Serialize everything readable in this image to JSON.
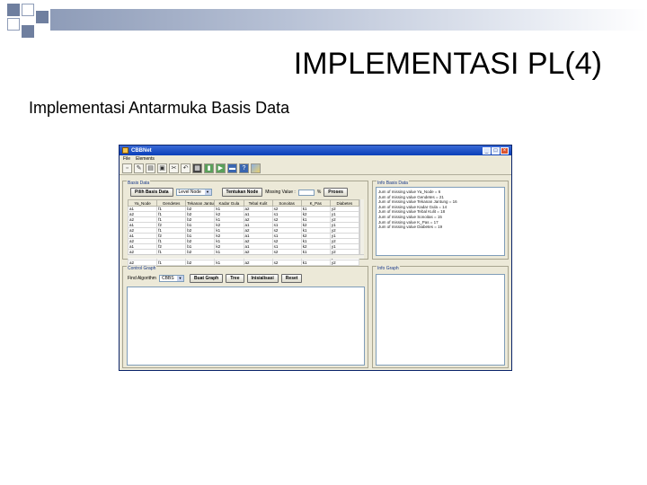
{
  "slide": {
    "title": "IMPLEMENTASI PL(4)",
    "subtitle": "Implementasi Antarmuka Basis Data"
  },
  "colors": {
    "window_border": "#0a246a",
    "titlebar": "#0a3fb8",
    "accent_band": "#8e9cb8"
  },
  "app": {
    "title": "CBBNet",
    "menu": [
      "File",
      "Elements"
    ],
    "toolbar_icons": [
      "new-icon",
      "edit-icon",
      "open-icon",
      "save-icon",
      "cut-icon",
      "undo-icon",
      "grid-icon",
      "export-icon",
      "play-icon",
      "chart-icon",
      "help-icon",
      "image-icon"
    ],
    "basis_data": {
      "label": "Basis Data",
      "pilih_button": "Pilih Basis Data",
      "combo_value": "Level Node",
      "tentukan_button": "Tentukan Node",
      "missing_label": "Missing Value :",
      "missing_unit": "%",
      "proses_button": "Proses",
      "columns": [
        "Ya_Node",
        "Gendetes",
        "Tekanan Jantung",
        "Kadar Gula",
        "Tebal Kulit",
        "Sonoitas",
        "K_Pas",
        "Diabetes"
      ],
      "rows": [
        [
          "a1",
          "f1",
          "b2",
          "k1",
          "a2",
          "s2",
          "k1",
          "y2"
        ],
        [
          "a2",
          "f1",
          "b2",
          "k2",
          "a1",
          "s1",
          "k2",
          "y1"
        ],
        [
          "a2",
          "f1",
          "b2",
          "k1",
          "a2",
          "s2",
          "k1",
          "y2"
        ],
        [
          "a1",
          "f2",
          "b1",
          "k2",
          "a1",
          "s1",
          "k2",
          "y1"
        ],
        [
          "a2",
          "f1",
          "b2",
          "k1",
          "a2",
          "s2",
          "k1",
          "y2"
        ],
        [
          "a1",
          "f2",
          "b1",
          "k2",
          "a1",
          "s1",
          "k2",
          "y1"
        ],
        [
          "a2",
          "f1",
          "b2",
          "k1",
          "a2",
          "s2",
          "k1",
          "y2"
        ],
        [
          "a1",
          "f2",
          "b1",
          "k2",
          "a1",
          "s1",
          "k2",
          "y1"
        ],
        [
          "a2",
          "f1",
          "b2",
          "k1",
          "a2",
          "s2",
          "k1",
          "y2"
        ],
        [
          "a1",
          "f2",
          "b1",
          "k2",
          "a1",
          "s1",
          "k2",
          "y1"
        ],
        [
          "a2",
          "f1",
          "b2",
          "k1",
          "a2",
          "s2",
          "k1",
          "y2"
        ]
      ]
    },
    "info": {
      "label": "Info Basis Data",
      "lines": [
        "Jum of missing value Ya_Node = 6",
        "Jum of missing value Gendetes = 21",
        "Jum of missing value Tekanan Jantung = 16",
        "Jum of missing value Kadar Gula = 14",
        "Jum of missing value Tebal Kulit = 18",
        "Jum of missing value Sonoitas = 15",
        "Jum of missing value K_Pas = 17",
        "Jum of missing value Diabetes = 19"
      ]
    },
    "control": {
      "label": "Control Graph",
      "metode_label": "Find Algorithm",
      "metode_value": "CBBS",
      "buttons": [
        "Buat Graph",
        "Tree",
        "Inisialisasi",
        "Reset"
      ]
    },
    "graph": {
      "label": "Info Graph"
    }
  }
}
